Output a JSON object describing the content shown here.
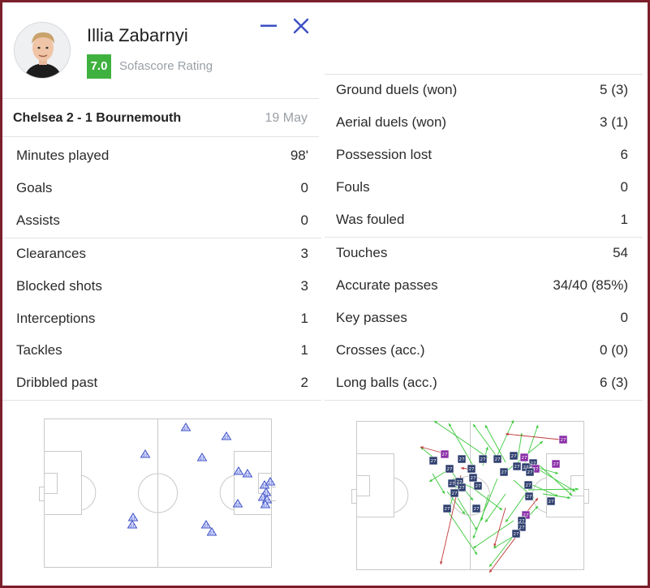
{
  "player": {
    "name": "Illia Zabarnyi",
    "rating": "7.0",
    "rating_label": "Sofascore Rating",
    "rating_color": "#3fb13f"
  },
  "match": {
    "title": "Chelsea 2 - 1 Bournemouth",
    "date": "19 May"
  },
  "left_stats": [
    {
      "label": "Minutes played",
      "value": "98'"
    },
    {
      "label": "Goals",
      "value": "0"
    },
    {
      "label": "Assists",
      "value": "0"
    },
    {
      "label": "Clearances",
      "value": "3"
    },
    {
      "label": "Blocked shots",
      "value": "3"
    },
    {
      "label": "Interceptions",
      "value": "1"
    },
    {
      "label": "Tackles",
      "value": "1"
    },
    {
      "label": "Dribbled past",
      "value": "2"
    }
  ],
  "right_stats": [
    {
      "label": "Ground duels (won)",
      "value": "5 (3)"
    },
    {
      "label": "Aerial duels (won)",
      "value": "3 (1)"
    },
    {
      "label": "Possession lost",
      "value": "6"
    },
    {
      "label": "Fouls",
      "value": "0"
    },
    {
      "label": "Was fouled",
      "value": "1"
    },
    {
      "label": "Touches",
      "value": "54"
    },
    {
      "label": "Accurate passes",
      "value": "34/40 (85%)"
    },
    {
      "label": "Key passes",
      "value": "0"
    },
    {
      "label": "Crosses (acc.)",
      "value": "0 (0)"
    },
    {
      "label": "Long balls (acc.)",
      "value": "6 (3)"
    }
  ],
  "heatmap_marker_label": "27",
  "colors": {
    "frame": "#7a1f2b",
    "accent_icon": "#3b4fc4",
    "marker_purple": "#8b2fa8",
    "marker_navy": "#2f3f6f",
    "pass_success": "#3cc93c",
    "pass_fail": "#c23b3b"
  }
}
